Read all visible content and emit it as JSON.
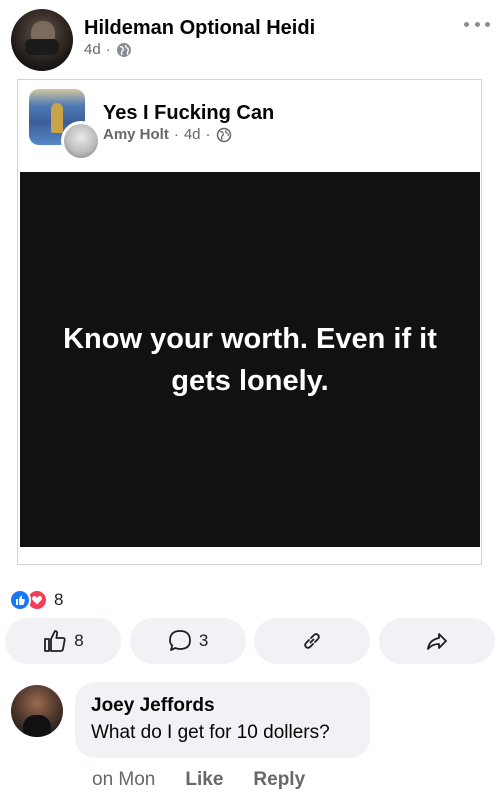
{
  "post": {
    "author": "Hildeman Optional Heidi",
    "time": "4d",
    "separator": "·",
    "audience_icon": "globe-icon",
    "more_icon": "more-options-icon"
  },
  "shared": {
    "group_name": "Yes I Fucking Can",
    "author": "Amy Holt",
    "time": "4d",
    "separator": "·",
    "audience_icon": "globe-icon",
    "quote": "Know your worth. Even if it gets lonely.",
    "quote_bg": "#111111",
    "quote_color": "#ffffff"
  },
  "reactions": {
    "types": [
      "like",
      "love"
    ],
    "count": "8",
    "like_color": "#1877f2",
    "love_color": "#f33e58"
  },
  "actions": {
    "like_count": "8",
    "comment_count": "3",
    "like_icon": "thumbs-up-icon",
    "comment_icon": "comment-icon",
    "send_icon": "link-icon",
    "share_icon": "share-icon"
  },
  "comment": {
    "author": "Joey Jeffords",
    "text": "What do I get for 10 dollers?",
    "time": "on Mon",
    "like_label": "Like",
    "reply_label": "Reply"
  },
  "colors": {
    "secondary_text": "#65676b",
    "button_bg": "#f0f2f5"
  }
}
